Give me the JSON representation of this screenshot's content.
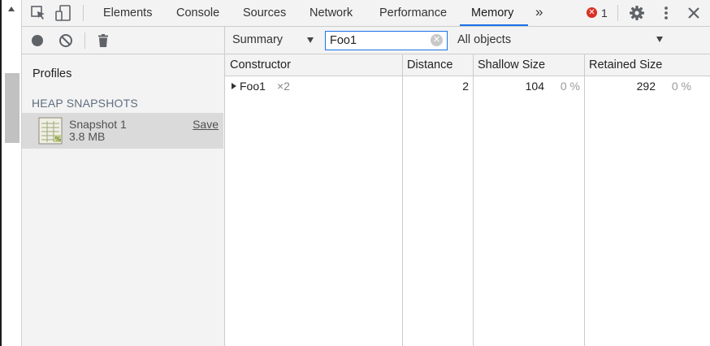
{
  "tabs": [
    {
      "label": "Elements",
      "active": false
    },
    {
      "label": "Console",
      "active": false
    },
    {
      "label": "Sources",
      "active": false
    },
    {
      "label": "Network",
      "active": false
    },
    {
      "label": "Performance",
      "active": false
    },
    {
      "label": "Memory",
      "active": true
    }
  ],
  "overflow_label": "»",
  "errors": {
    "count": "1",
    "color": "#d93025"
  },
  "accent_color": "#1a73e8",
  "left_toolbar": {
    "icons": [
      "record-icon",
      "clear-all-icon",
      "trash-icon"
    ]
  },
  "sidebar": {
    "title": "Profiles",
    "section": "HEAP SNAPSHOTS",
    "snapshot": {
      "name": "Snapshot 1",
      "size": "3.8 MB",
      "save_label": "Save"
    }
  },
  "toolbar": {
    "view": "Summary",
    "filter_value": "Foo1",
    "class_filter": "All objects"
  },
  "grid": {
    "columns": [
      "Constructor",
      "Distance",
      "Shallow Size",
      "Retained Size"
    ],
    "rows": [
      {
        "constructor": "Foo1",
        "count": "×2",
        "distance": "2",
        "shallow_size": "104",
        "shallow_pct": "0 %",
        "retained_size": "292",
        "retained_pct": "0 %"
      }
    ]
  }
}
